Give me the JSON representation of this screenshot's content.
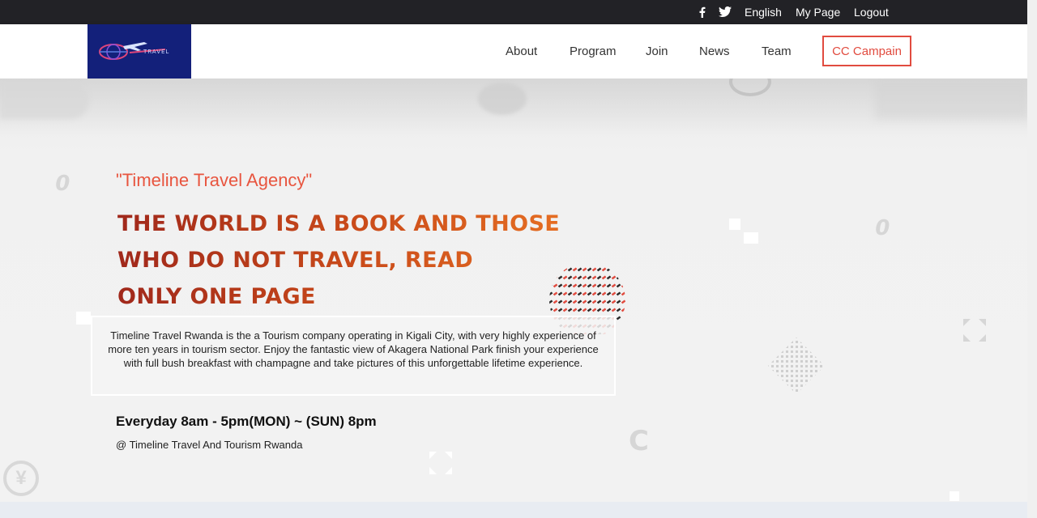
{
  "topbar": {
    "icons": [
      "facebook-icon",
      "twitter-icon"
    ],
    "language": "English",
    "mypage": "My Page",
    "logout": "Logout"
  },
  "logo": {
    "text": "TRAVEL",
    "colors": {
      "bg": "#13207a",
      "accent": "#e0457a"
    }
  },
  "nav": {
    "items": [
      "About",
      "Program",
      "Join",
      "News",
      "Team"
    ],
    "cta": "CC Campain"
  },
  "hero": {
    "subtitle": "\"Timeline Travel Agency\"",
    "headline_lines": [
      "THE WORLD IS A BOOK AND THOSE",
      "WHO DO NOT TRAVEL, READ",
      "ONLY ONE PAGE"
    ],
    "description": "Timeline Travel Rwanda is the a Tourism company operating in Kigali City, with very highly experience of more ten years in tourism sector. Enjoy the fantastic view of Akagera National Park finish your experience with full bush breakfast with champagne and take pictures of this unforgettable lifetime experience.",
    "hours": "Everyday 8am - 5pm(MON) ~ (SUN) 8pm",
    "address": "@ Timeline Travel And Tourism Rwanda"
  },
  "colors": {
    "accent": "#e14b3f",
    "topbar": "#222226",
    "headline_dark": "#a0281b",
    "headline_light": "#ef7a25"
  }
}
